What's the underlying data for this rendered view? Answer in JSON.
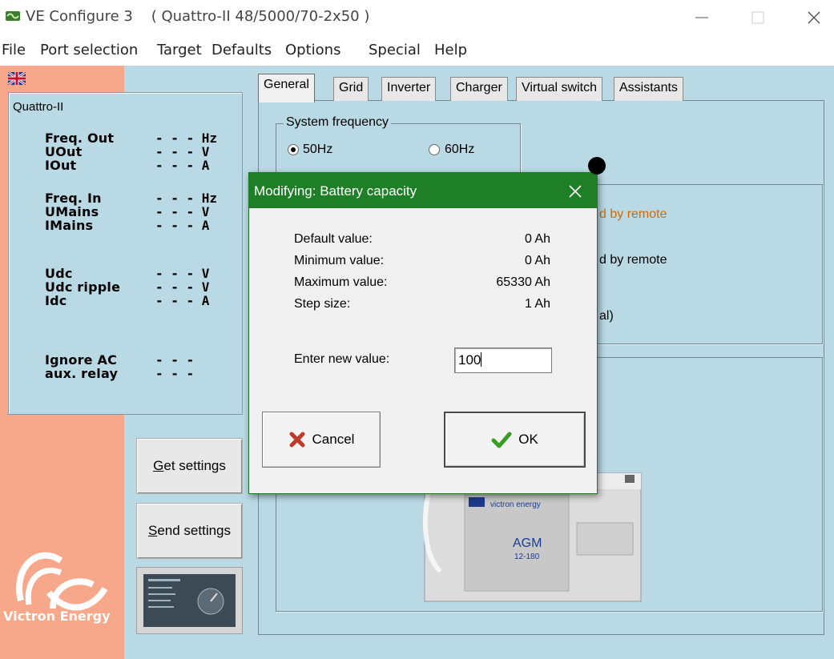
{
  "window": {
    "title": "VE Configure 3    ( Quattro-II 48/5000/70-2x50 )"
  },
  "menu": [
    "File",
    "Port selection",
    "Target",
    "Defaults",
    "Options",
    "Special",
    "Help"
  ],
  "status": {
    "title": "Quattro-II",
    "rows": [
      {
        "label": "Freq. Out",
        "value": "- - - Hz"
      },
      {
        "label": "UOut",
        "value": "- - - V"
      },
      {
        "label": "IOut",
        "value": "- - - A"
      },
      {
        "label": "Freq. In",
        "value": "- - - Hz"
      },
      {
        "label": "UMains",
        "value": "- - - V"
      },
      {
        "label": "IMains",
        "value": "- - - A"
      },
      {
        "label": "Udc",
        "value": "- - - V"
      },
      {
        "label": "Udc ripple",
        "value": "- - - V"
      },
      {
        "label": "Idc",
        "value": "- - - A"
      },
      {
        "label": "Ignore AC",
        "value": "- - -"
      },
      {
        "label": "aux. relay",
        "value": "- - -"
      }
    ]
  },
  "buttons": {
    "get_settings_u": "G",
    "get_settings_rest": "et settings",
    "send_settings_u": "S",
    "send_settings_rest": "end settings"
  },
  "logo": {
    "text": "Victron Energy"
  },
  "tabs": [
    "General",
    "Grid",
    "Inverter",
    "Charger",
    "Virtual switch",
    "Assistants"
  ],
  "general": {
    "system_frequency_label": "System frequency",
    "freq_50": "50Hz",
    "freq_60": "60Hz",
    "selected": "50Hz",
    "bg_text_1": "d by remote",
    "bg_text_2": "d by remote",
    "bg_text_3": "al)"
  },
  "dialog": {
    "title": "Modifying: Battery capacity",
    "rows": [
      {
        "label": "Default value:",
        "value": "0 Ah"
      },
      {
        "label": "Minimum value:",
        "value": "0 Ah"
      },
      {
        "label": "Maximum value:",
        "value": "65330 Ah"
      },
      {
        "label": "Step size:",
        "value": "1 Ah"
      }
    ],
    "input_label": "Enter new value:",
    "input_value": "100",
    "cancel_label": "Cancel",
    "ok_label": "OK"
  },
  "battery_image": {
    "brand": "victron energy",
    "model": "AGM",
    "capacity": "12-180"
  },
  "colors": {
    "dialog_title_bg": "#1f7f26",
    "main_bg": "#b9d9e4",
    "left_panel_bg": "#f7a78a",
    "orange_text": "#d36a00"
  }
}
